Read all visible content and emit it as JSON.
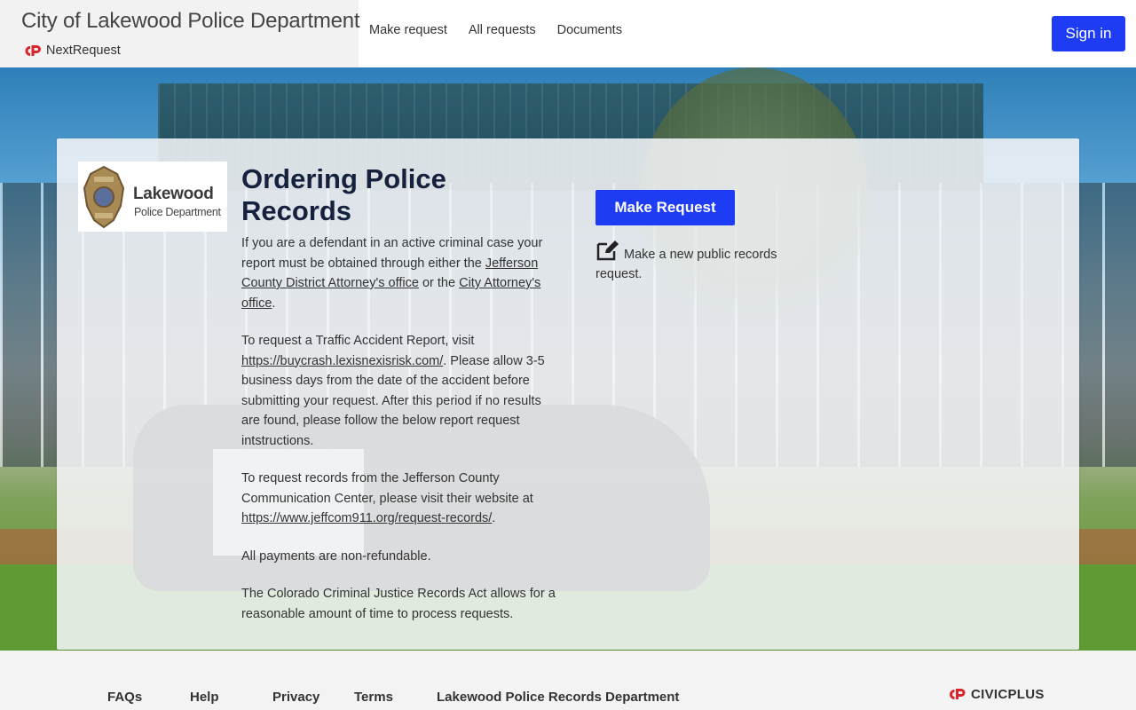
{
  "header": {
    "site_title": "City of Lakewood Police Department",
    "platform_name": "NextRequest",
    "nav": [
      "Make request",
      "All requests",
      "Documents"
    ],
    "signin_label": "Sign in"
  },
  "card": {
    "logo": {
      "name": "Lakewood",
      "subtitle": "Police Department"
    },
    "title": "Ordering Police Records",
    "p1": {
      "pre": "If you are a defendant in an active criminal case your report must be obtained through either the ",
      "link1": "Jefferson County District Attorney's office",
      "mid": " or the ",
      "link2": "City Attorney's office",
      "post": "."
    },
    "p2": {
      "pre": "To request a Traffic Accident Report, visit ",
      "link": "https://buycrash.lexisnexisrisk.com/",
      "post": ". Please allow 3-5 business days from the date of the accident before submitting your request. After this period if no results are found, please follow the below report request intstructions."
    },
    "p3": {
      "pre": "To request records from the Jefferson County Communication Center, please visit their website at ",
      "link": "https://www.jeffcom911.org/request-records/",
      "post": "."
    },
    "p4": "All payments are non-refundable.",
    "p5": "The Colorado Criminal Justice Records Act allows for a reasonable amount of time to process requests.",
    "make_request_label": "Make Request",
    "make_request_desc": "Make a new public records request."
  },
  "footer": {
    "links": [
      "FAQs",
      "Help",
      "Privacy",
      "Terms",
      "Lakewood Police Records Department"
    ],
    "brand": "CIVICPLUS"
  },
  "colors": {
    "accent": "#1f3cf5",
    "brand_red": "#d7262e",
    "title_navy": "#16213e"
  },
  "icons": {
    "platform": "nextrequest-logo-icon",
    "edit": "edit-pencil-icon",
    "footer": "civicplus-logo-icon"
  }
}
